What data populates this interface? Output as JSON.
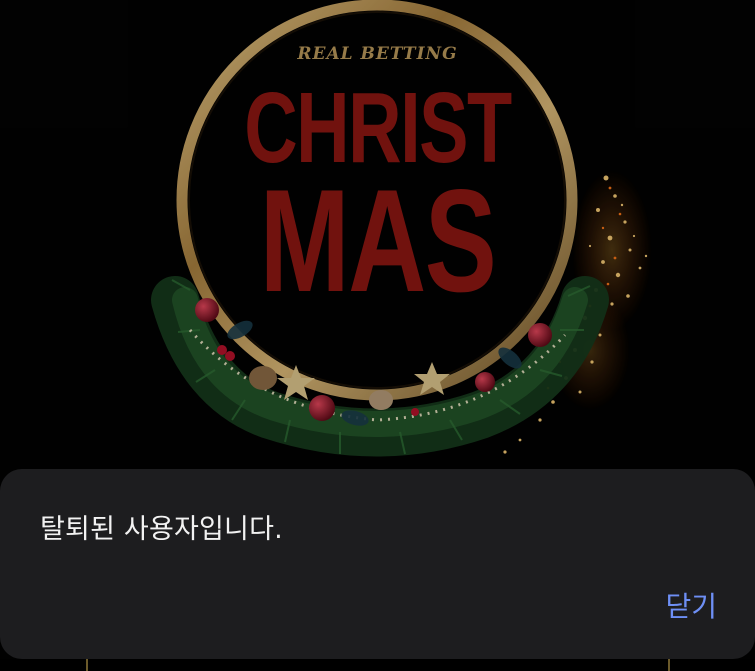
{
  "banner": {
    "brand_text": "REAL BETTING",
    "title_line1": "CHRIST",
    "title_line2": "MAS"
  },
  "dialog": {
    "message": "탈퇴된 사용자입니다.",
    "close_label": "닫기"
  },
  "colors": {
    "background": "#020202",
    "ring_gold": "#c9a25e",
    "title_red": "#8a1612",
    "dialog_bg": "#1d1d1f",
    "message_text": "#f2f2f2",
    "close_accent": "#6e8ff5"
  }
}
